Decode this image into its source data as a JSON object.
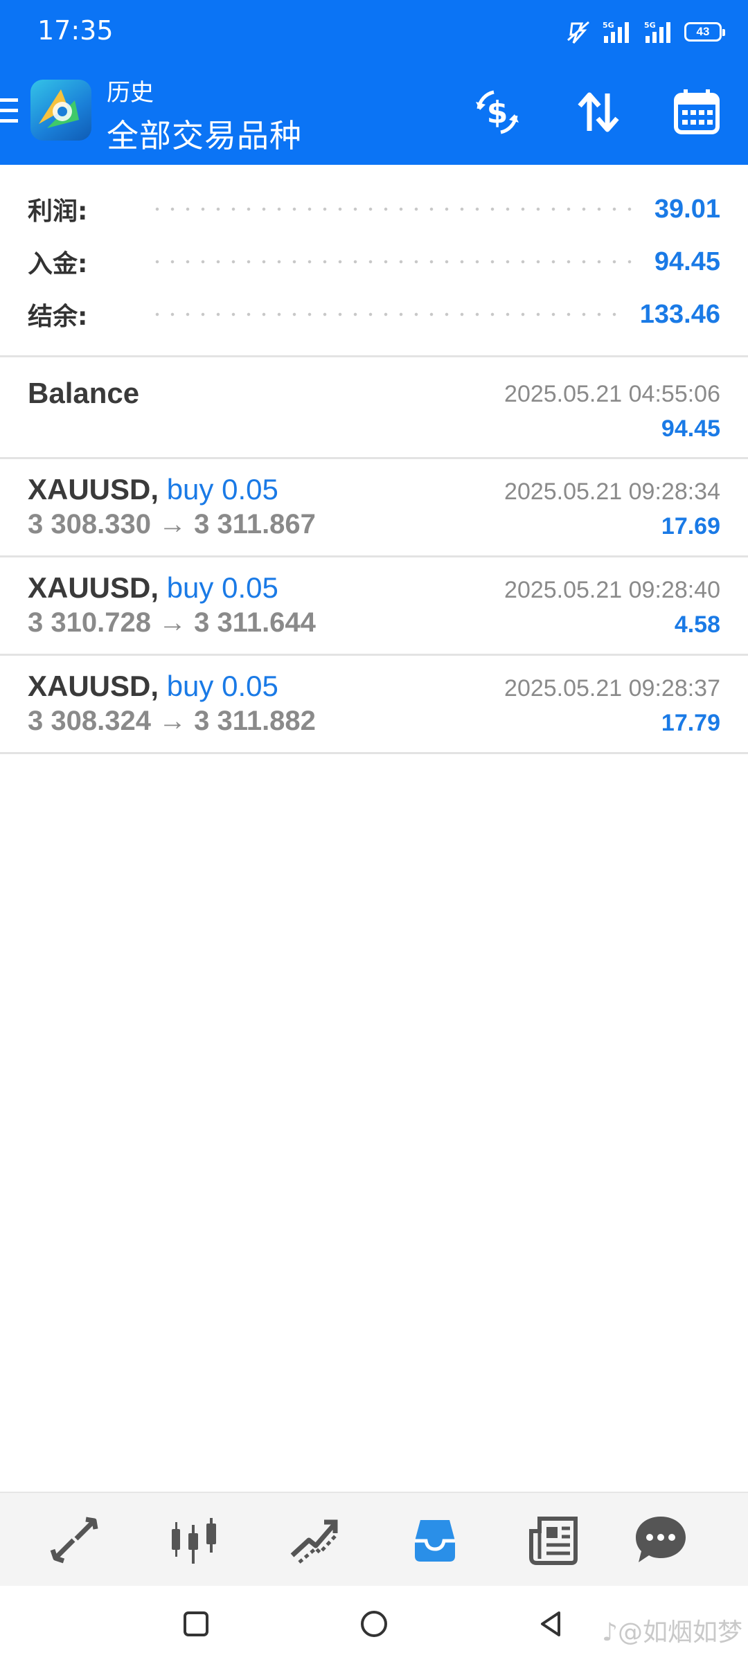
{
  "status_bar": {
    "time": "17:35",
    "battery": "43",
    "network_label": "5G"
  },
  "header": {
    "title_small": "历史",
    "title_large": "全部交易品种",
    "colors": {
      "background": "#0b74f5",
      "text": "#ffffff"
    },
    "icons": [
      "menu-icon",
      "metatrader-logo",
      "currency-exchange-icon",
      "sort-icon",
      "calendar-icon"
    ]
  },
  "summary": [
    {
      "label": "利润:",
      "value": "39.01"
    },
    {
      "label": "入金:",
      "value": "94.45"
    },
    {
      "label": "结余:",
      "value": "133.46"
    }
  ],
  "deals": [
    {
      "title": "Balance",
      "time": "2025.05.21 04:55:06",
      "profit": "94.45"
    },
    {
      "symbol": "XAUUSD,",
      "side": "buy 0.05",
      "prices": "3 308.330 → 3 311.867",
      "time": "2025.05.21 09:28:34",
      "profit": "17.69"
    },
    {
      "symbol": "XAUUSD,",
      "side": "buy 0.05",
      "prices": "3 310.728 → 3 311.644",
      "time": "2025.05.21 09:28:40",
      "profit": "4.58"
    },
    {
      "symbol": "XAUUSD,",
      "side": "buy 0.05",
      "prices": "3 308.324 → 3 311.882",
      "time": "2025.05.21 09:28:37",
      "profit": "17.79"
    }
  ],
  "tabbar": {
    "items": [
      "quotes-icon",
      "chart-icon",
      "trade-icon",
      "history-icon",
      "news-icon",
      "chat-icon"
    ],
    "active": "history-icon",
    "active_color": "#2a8fe8",
    "inactive_color": "#555555"
  },
  "system_nav": {
    "watermark": "♪@如烟如梦"
  }
}
